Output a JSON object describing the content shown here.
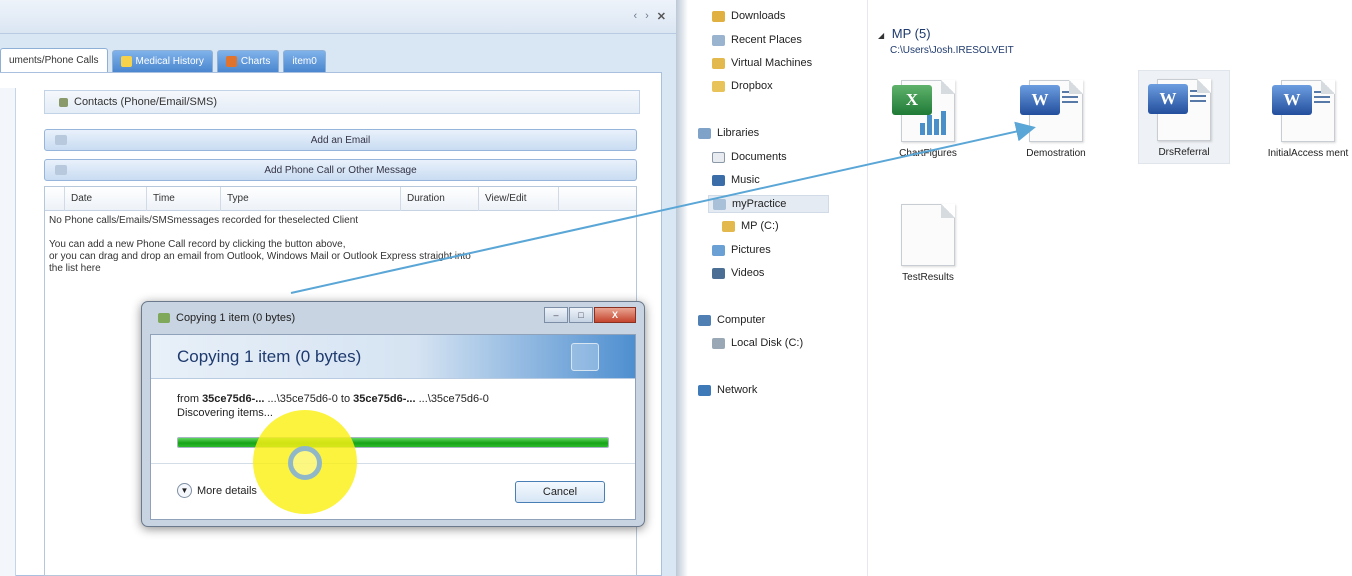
{
  "app": {
    "window_controls": {
      "prev": "‹",
      "next": "›",
      "close": "✕"
    },
    "tabs": [
      {
        "label": "uments/Phone Calls",
        "active": true
      },
      {
        "label": "Medical History",
        "active": false
      },
      {
        "label": "Charts",
        "active": false
      },
      {
        "label": "item0",
        "active": false
      }
    ],
    "contacts_header": "Contacts (Phone/Email/SMS)",
    "add_email_label": "Add an Email",
    "add_phone_label": "Add Phone Call or Other Message",
    "grid": {
      "columns": [
        "Date",
        "Time",
        "Type",
        "Duration",
        "View/Edit"
      ],
      "empty_message": "No Phone calls/Emails/SMSmessages recorded for theselected Client",
      "hint_line1": "You can add a new Phone Call record by clicking the button above,",
      "hint_line2": "or you can drag and drop an email from Outlook, Windows Mail or Outlook Express straight into",
      "hint_line3": "the list here"
    }
  },
  "copy_dialog": {
    "title": "Copying 1 item (0 bytes)",
    "heading": "Copying 1 item (0 bytes)",
    "from_word": "from",
    "from_name": "35ce75d6-...",
    "from_path": "...\\35ce75d6-0",
    "to_word": "to",
    "to_name": "35ce75d6-...",
    "to_path": "...\\35ce75d6-0",
    "status": "Discovering items...",
    "progress": 1.0,
    "more_details": "More details",
    "cancel": "Cancel",
    "close_glyph": "X"
  },
  "explorer": {
    "nav": {
      "downloads": "Downloads",
      "recent_places": "Recent Places",
      "virtual_machines": "Virtual Machines",
      "dropbox": "Dropbox",
      "libraries": "Libraries",
      "documents": "Documents",
      "music": "Music",
      "mypractice": "myPractice",
      "mp_c": "MP (C:)",
      "pictures": "Pictures",
      "videos": "Videos",
      "computer": "Computer",
      "local_disk": "Local Disk (C:)",
      "network": "Network"
    },
    "group_title": "MP (5)",
    "group_path": "C:\\Users\\Josh.IRESOLVEIT",
    "files": [
      {
        "name": "ChartFigures",
        "type": "excel"
      },
      {
        "name": "Demostration",
        "type": "word"
      },
      {
        "name": "DrsReferral",
        "type": "word"
      },
      {
        "name": "InitialAccess ment",
        "type": "word"
      },
      {
        "name": "TestResults",
        "type": "blank"
      }
    ]
  },
  "colors": {
    "progress_green": "#17a317",
    "drag_arrow": "#5aa6d6",
    "cursor_highlight": "#faf014",
    "accent_blue": "#4a86cf"
  }
}
